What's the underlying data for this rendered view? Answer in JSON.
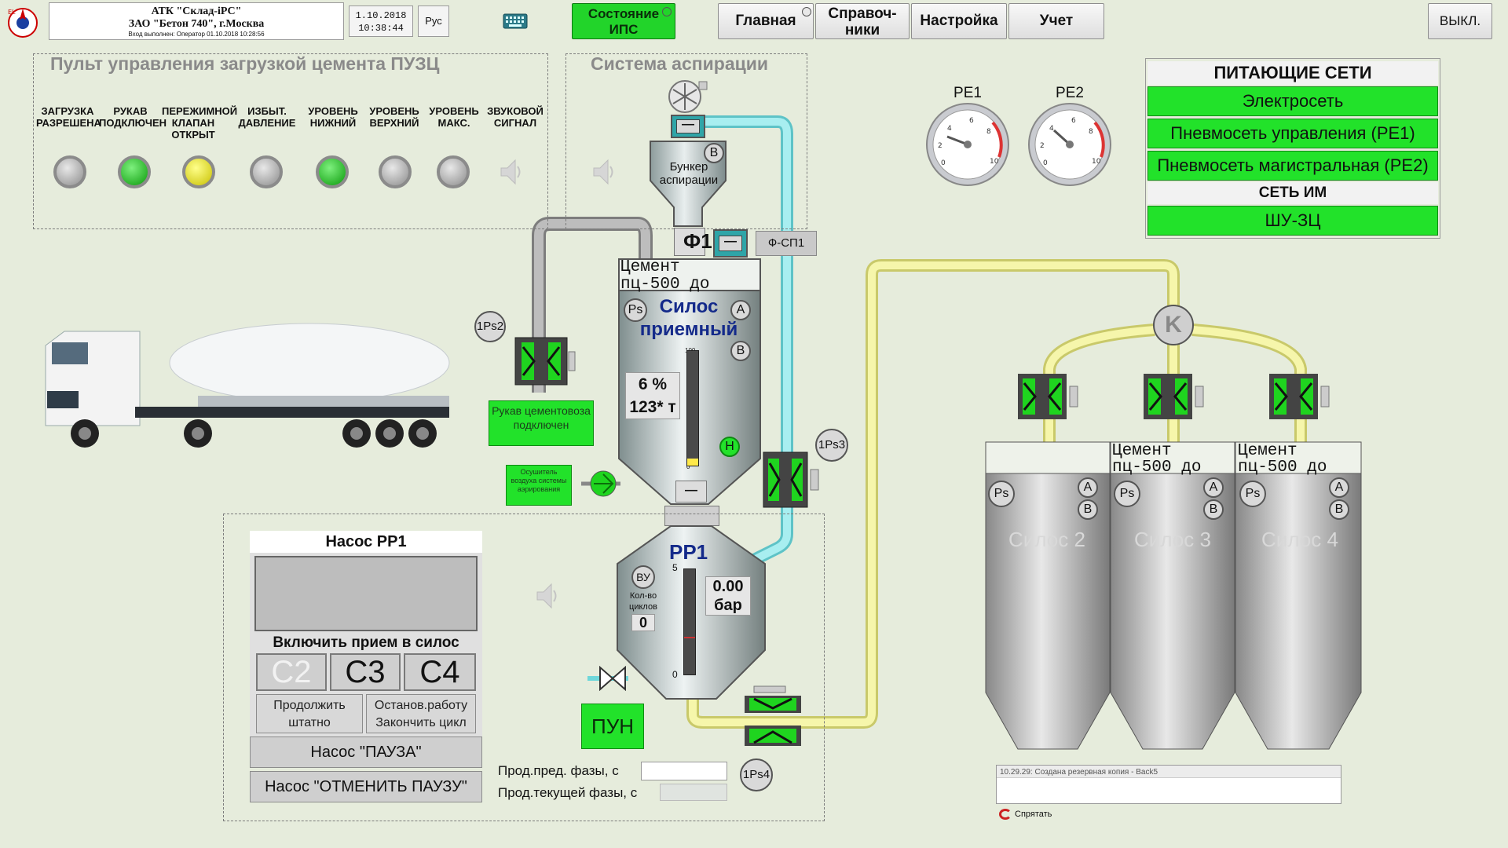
{
  "header": {
    "org_line1": "АТК \"Склад-iPC\"",
    "org_line2": "ЗАО \"Бетон 740\", г.Москва",
    "org_line3": "Вход выполнен: Оператор 01.10.2018 10:28:56",
    "date": "1.10.2018",
    "time": "10:38:44",
    "lang": "Рус",
    "state_btn": "Состояние ИПС",
    "nav": [
      "Главная",
      "Справоч-ники",
      "Настройка",
      "Учет"
    ],
    "exit": "ВЫКЛ."
  },
  "loading_panel": {
    "title": "Пульт управления загрузкой цемента ПУЗЦ",
    "lamps": [
      {
        "label": "ЗАГРУЗКА РАЗРЕШЕНА",
        "state": "off"
      },
      {
        "label": "РУКАВ ПОДКЛЮЧЕН",
        "state": "green"
      },
      {
        "label": "ПЕРЕЖИМНОЙ КЛАПАН ОТКРЫТ",
        "state": "yellow"
      },
      {
        "label": "ИЗБЫТ. ДАВЛЕНИЕ",
        "state": "off"
      },
      {
        "label": "УРОВЕНЬ НИЖНИЙ",
        "state": "green"
      },
      {
        "label": "УРОВЕНЬ ВЕРХНИЙ",
        "state": "off"
      },
      {
        "label": "УРОВЕНЬ МАКС.",
        "state": "off"
      },
      {
        "label": "ЗВУКОВОЙ СИГНАЛ",
        "state": "speaker"
      }
    ]
  },
  "aspiration": {
    "title": "Система аспирации",
    "bunker": "Бункер аспирации",
    "bunker_tag": "B",
    "filter": "Ф1",
    "filter_tag": "Ф-СП1"
  },
  "receiver_silo": {
    "cement": "Цемент",
    "grade": "пц-500 до",
    "name": "Силос приемный",
    "ps": "Ps",
    "a": "A",
    "b": "B",
    "percent": "6 %",
    "tons": "123* т",
    "scale_top": "100",
    "scale_bottom": "0",
    "level_frac": 0.06,
    "h": "Н"
  },
  "hose": {
    "label": "Рукав цементовоза подключен",
    "valve": "1Ps2",
    "aeration": "Осушитель воздуха системы аэрирования"
  },
  "pump": {
    "name": "РР1",
    "vu": "ВУ",
    "cycles_label": "Кол-во циклов",
    "cycles": "0",
    "pressure": "0.00",
    "unit": "бар",
    "scale_top": "5",
    "scale_bottom": "0",
    "pun": "ПУН",
    "v3": "1Ps3",
    "v4": "1Ps4"
  },
  "pump_panel": {
    "title": "Насос РР1",
    "enable": "Включить прием в силос",
    "silos": [
      "C2",
      "C3",
      "C4"
    ],
    "continue": "Продолжить штатно",
    "stop": "Останов.работу Закончить цикл",
    "pause": "Насос \"ПАУЗА\"",
    "unpause": "Насос \"ОТМЕНИТЬ ПАУЗУ\"",
    "prev_phase": "Прод.пред. фазы, с",
    "cur_phase": "Прод.текущей фазы, с"
  },
  "gauges": [
    "PE1",
    "PE2"
  ],
  "networks": {
    "title": "ПИТАЮЩИЕ СЕТИ",
    "items": [
      "Электросеть",
      "Пневмосеть управления (PE1)",
      "Пневмосеть магистральная (PE2)"
    ],
    "im_title": "СЕТЬ ИМ",
    "im_items": [
      "ШУ-ЗЦ"
    ]
  },
  "distributor": "K",
  "silos": [
    {
      "name": "Силос 2",
      "cement": "",
      "grade": ""
    },
    {
      "name": "Силос 3",
      "cement": "Цемент",
      "grade": "пц-500 до"
    },
    {
      "name": "Силос 4",
      "cement": "Цемент",
      "grade": "пц-500 до"
    }
  ],
  "log": {
    "entry": "10.29.29: Создана резервная копия - Back5",
    "hide": "Спрятать"
  },
  "colors": {
    "green": "#22e22a",
    "pipe_yellow": "#f3f2a0",
    "pipe_cyan": "#9fe8ea",
    "pipe_gray": "#a9a9a9"
  }
}
